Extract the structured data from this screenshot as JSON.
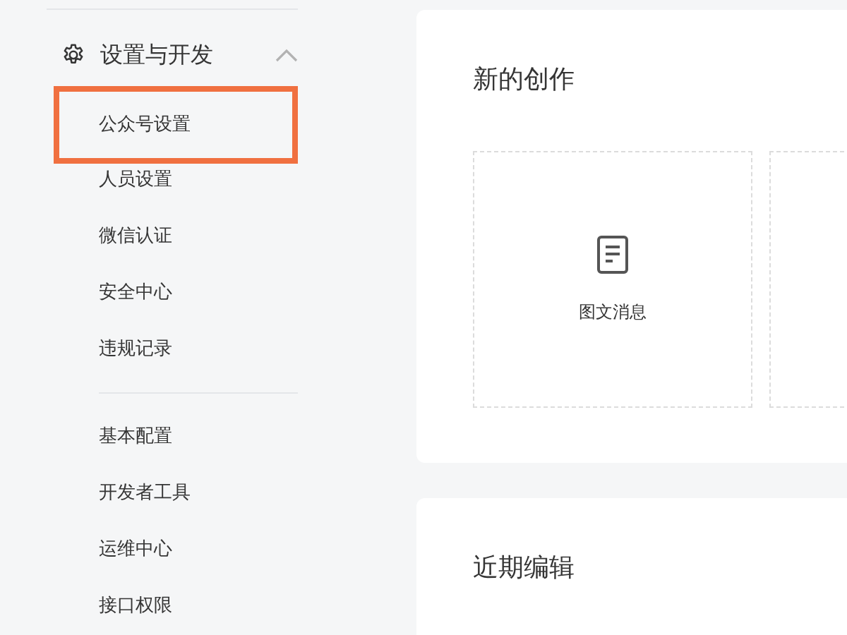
{
  "sidebar": {
    "section": {
      "title": "设置与开发",
      "expanded": true
    },
    "groups": [
      [
        {
          "label": "公众号设置",
          "highlighted": true
        },
        {
          "label": "人员设置",
          "highlighted": false
        },
        {
          "label": "微信认证",
          "highlighted": false
        },
        {
          "label": "安全中心",
          "highlighted": false
        },
        {
          "label": "违规记录",
          "highlighted": false
        }
      ],
      [
        {
          "label": "基本配置",
          "highlighted": false
        },
        {
          "label": "开发者工具",
          "highlighted": false
        },
        {
          "label": "运维中心",
          "highlighted": false
        },
        {
          "label": "接口权限",
          "highlighted": false
        }
      ]
    ]
  },
  "create_card": {
    "title": "新的创作",
    "tiles": [
      {
        "label": "图文消息"
      }
    ]
  },
  "recent_card": {
    "title": "近期编辑"
  }
}
